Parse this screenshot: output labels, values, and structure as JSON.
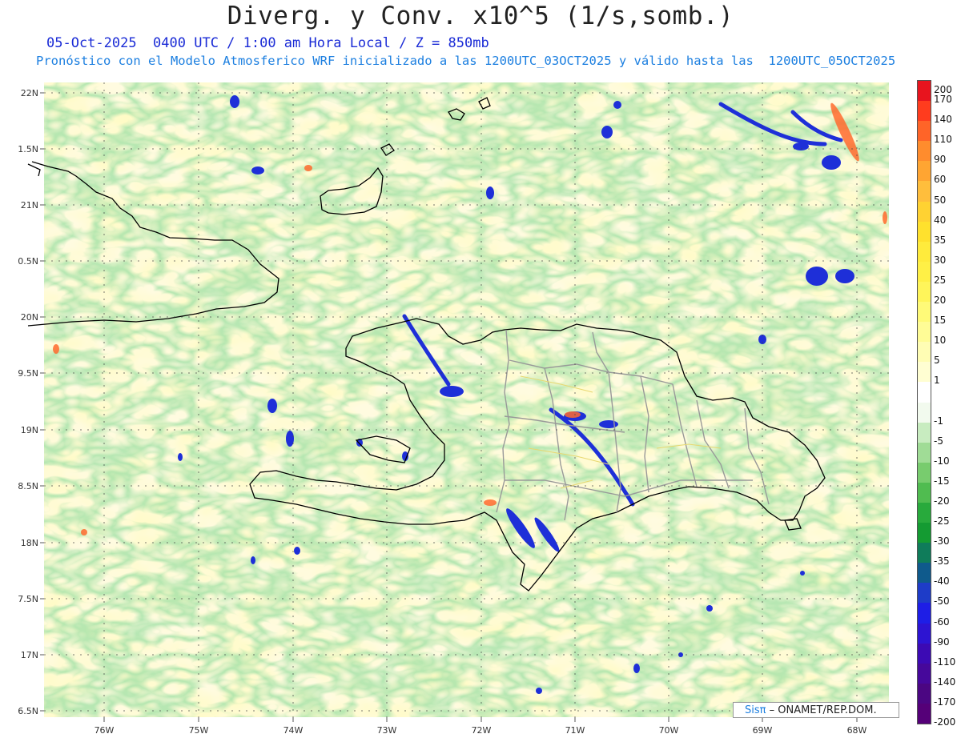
{
  "header": {
    "title": "Diverg. y Conv. x10^5 (1/s,somb.)",
    "subtitle_line1": "05-Oct-2025  0400 UTC / 1:00 am Hora Local / Z = 850mb",
    "subtitle_line2": "Pronóstico con el Modelo Atmosferico WRF inicializado a las 1200UTC_03OCT2025 y válido hasta las  1200UTC_05OCT2025"
  },
  "axes": {
    "lat_labels": [
      "22N",
      "1.5N",
      "21N",
      "0.5N",
      "20N",
      "9.5N",
      "19N",
      "8.5N",
      "18N",
      "7.5N",
      "17N",
      "6.5N"
    ],
    "lon_labels": [
      "76W",
      "75W",
      "74W",
      "73W",
      "72W",
      "71W",
      "70W",
      "69W",
      "68W"
    ]
  },
  "colorbar": {
    "labels": [
      "200",
      "170",
      "140",
      "110",
      "90",
      "60",
      "50",
      "40",
      "35",
      "30",
      "25",
      "20",
      "15",
      "10",
      "5",
      "1",
      "-1",
      "-5",
      "-10",
      "-15",
      "-20",
      "-25",
      "-30",
      "-35",
      "-40",
      "-50",
      "-60",
      "-90",
      "-110",
      "-140",
      "-170",
      "-200"
    ],
    "colors": [
      "#e8141e",
      "#ff3c1e",
      "#ff6428",
      "#ff8c2d",
      "#ffa532",
      "#ffbe3c",
      "#ffd232",
      "#ffe12d",
      "#ffeb3c",
      "#fff046",
      "#fff55a",
      "#fffa78",
      "#fffc96",
      "#fffdb4",
      "#fffed2",
      "#ffffff",
      "#f2faee",
      "#c8ecc0",
      "#a0dc96",
      "#78cc6e",
      "#50bc50",
      "#28aa3c",
      "#149b32",
      "#0f7c5a",
      "#0f5a8c",
      "#1e3cc8",
      "#1e1ee6",
      "#2d14d2",
      "#3c0ab4",
      "#46089b",
      "#4b0682",
      "#550078"
    ]
  },
  "credit": {
    "sis": "Sisπ",
    "text": "– ONAMET/REP.DOM."
  }
}
